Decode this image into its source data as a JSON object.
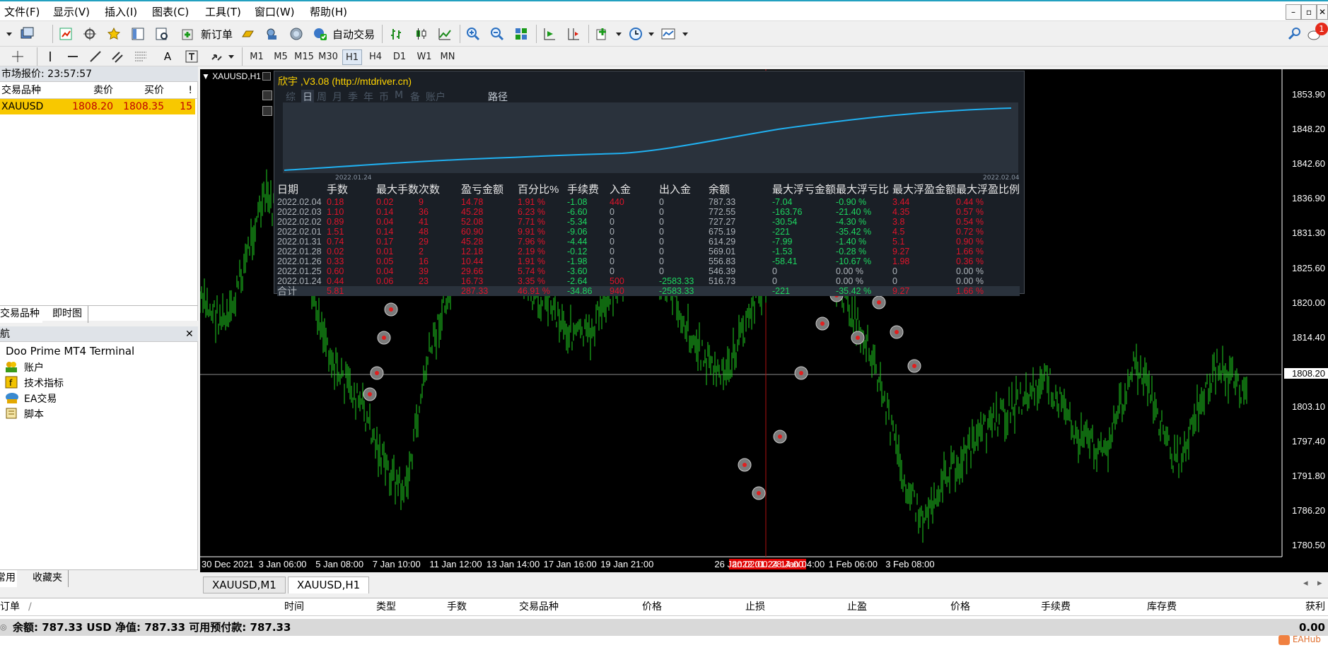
{
  "menu": {
    "file": "文件(F)",
    "view": "显示(V)",
    "insert": "插入(I)",
    "charts": "图表(C)",
    "tools": "工具(T)",
    "window": "窗口(W)",
    "help": "帮助(H)"
  },
  "window_buttons": [
    "–",
    "▫",
    "✕"
  ],
  "toolbar": {
    "new_order": "新订单",
    "auto_trade": "自动交易",
    "notification_count": "1"
  },
  "timeframes": [
    "M1",
    "M5",
    "M15",
    "M30",
    "H1",
    "H4",
    "D1",
    "W1",
    "MN"
  ],
  "market_watch": {
    "title": "市场报价: 23:57:57",
    "col_symbol": "交易品种",
    "col_bid": "卖价",
    "col_ask": "买价",
    "col_spread": "!",
    "row": {
      "symbol": "XAUUSD",
      "bid": "1808.20",
      "ask": "1808.35",
      "spread": "15"
    },
    "tabs": [
      "交易品种",
      "即时图"
    ]
  },
  "navigator": {
    "title": "导航",
    "root": "Doo Prime MT4 Terminal",
    "items": [
      "账户",
      "技术指标",
      "EA交易",
      "脚本"
    ],
    "tabs": [
      "常用",
      "收藏夹"
    ]
  },
  "chart": {
    "symbol_label": "XAUUSD,H1",
    "prices": [
      "1853.90",
      "1848.20",
      "1842.60",
      "1836.90",
      "1831.30",
      "1825.60",
      "1820.00",
      "1814.40",
      "1808.20",
      "1803.10",
      "1797.40",
      "1791.80",
      "1786.20",
      "1780.50"
    ],
    "current_price": "1808.20",
    "dates": [
      "30 Dec 2021",
      "3 Jan 06:00",
      "5 Jan 08:00",
      "7 Jan 10:00",
      "11 Jan 12:00",
      "13 Jan 14:00",
      "17 Jan 16:00",
      "19 Jan 21:00",
      "2022.01.24 14:00",
      "26 Jan 02:00",
      "28 Jan 04:00",
      "1 Feb 06:00",
      "3 Feb 08:00"
    ],
    "colors": {
      "bars": "#1fd11f",
      "crosshair": "#d01010",
      "panel_header": "#ffd400"
    }
  },
  "panel": {
    "title": "欣宇 ,V3.08 (http://mtdriver.cn)",
    "tabs": [
      "综",
      "日",
      "周",
      "月",
      "季",
      "年",
      "币",
      "M",
      "备",
      "账户",
      "路径"
    ],
    "active_tab": "日",
    "equity_start_label": "2022.01.24",
    "equity_end_label": "2022.02.04",
    "columns": [
      "日期",
      "手数",
      "最大手数",
      "次数",
      "盈亏金额",
      "百分比%",
      "手续费",
      "入金",
      "出入金",
      "余额",
      "最大浮亏金额",
      "最大浮亏比",
      "最大浮盈金额",
      "最大浮盈比例"
    ],
    "rows": [
      [
        "2022.02.04",
        "0.18",
        "0.02",
        "9",
        "14.78",
        "1.91 %",
        "-1.08",
        "440",
        "0",
        "787.33",
        "-7.04",
        "-0.90 %",
        "3.44",
        "0.44 %"
      ],
      [
        "2022.02.03",
        "1.10",
        "0.14",
        "36",
        "45.28",
        "6.23 %",
        "-6.60",
        "0",
        "0",
        "772.55",
        "-163.76",
        "-21.40 %",
        "4.35",
        "0.57 %"
      ],
      [
        "2022.02.02",
        "0.89",
        "0.04",
        "41",
        "52.08",
        "7.71 %",
        "-5.34",
        "0",
        "0",
        "727.27",
        "-30.54",
        "-4.30 %",
        "3.8",
        "0.54 %"
      ],
      [
        "2022.02.01",
        "1.51",
        "0.14",
        "48",
        "60.90",
        "9.91 %",
        "-9.06",
        "0",
        "0",
        "675.19",
        "-221",
        "-35.42 %",
        "4.5",
        "0.72 %"
      ],
      [
        "2022.01.31",
        "0.74",
        "0.17",
        "29",
        "45.28",
        "7.96 %",
        "-4.44",
        "0",
        "0",
        "614.29",
        "-7.99",
        "-1.40 %",
        "5.1",
        "0.90 %"
      ],
      [
        "2022.01.28",
        "0.02",
        "0.01",
        "2",
        "12.18",
        "2.19 %",
        "-0.12",
        "0",
        "0",
        "569.01",
        "-1.53",
        "-0.28 %",
        "9.27",
        "1.66 %"
      ],
      [
        "2022.01.26",
        "0.33",
        "0.05",
        "16",
        "10.44",
        "1.91 %",
        "-1.98",
        "0",
        "0",
        "556.83",
        "-58.41",
        "-10.67 %",
        "1.98",
        "0.36 %"
      ],
      [
        "2022.01.25",
        "0.60",
        "0.04",
        "39",
        "29.66",
        "5.74 %",
        "-3.60",
        "0",
        "0",
        "546.39",
        "0",
        "0.00 %",
        "0",
        "0.00 %"
      ],
      [
        "2022.01.24",
        "0.44",
        "0.06",
        "23",
        "16.73",
        "3.35 %",
        "-2.64",
        "500",
        "-2583.33",
        "516.73",
        "0",
        "0.00 %",
        "0",
        "0.00 %"
      ]
    ],
    "total": [
      "合计",
      "5.81",
      "",
      "",
      "287.33",
      "46.91 %",
      "-34.86",
      "940",
      "-2583.33",
      "",
      "-221",
      "-35.42 %",
      "9.27",
      "1.66 %"
    ]
  },
  "chart_tabs": [
    "XAUUSD,M1",
    "XAUUSD,H1"
  ],
  "terminal": {
    "columns": [
      "订单",
      "时间",
      "类型",
      "手数",
      "交易品种",
      "价格",
      "止损",
      "止盈",
      "价格",
      "手续费",
      "库存费",
      "获利"
    ],
    "balance_text": "余额: 787.33 USD  净值: 787.33  可用预付款: 787.33",
    "profit": "0.00",
    "watermark": "EAHub"
  }
}
